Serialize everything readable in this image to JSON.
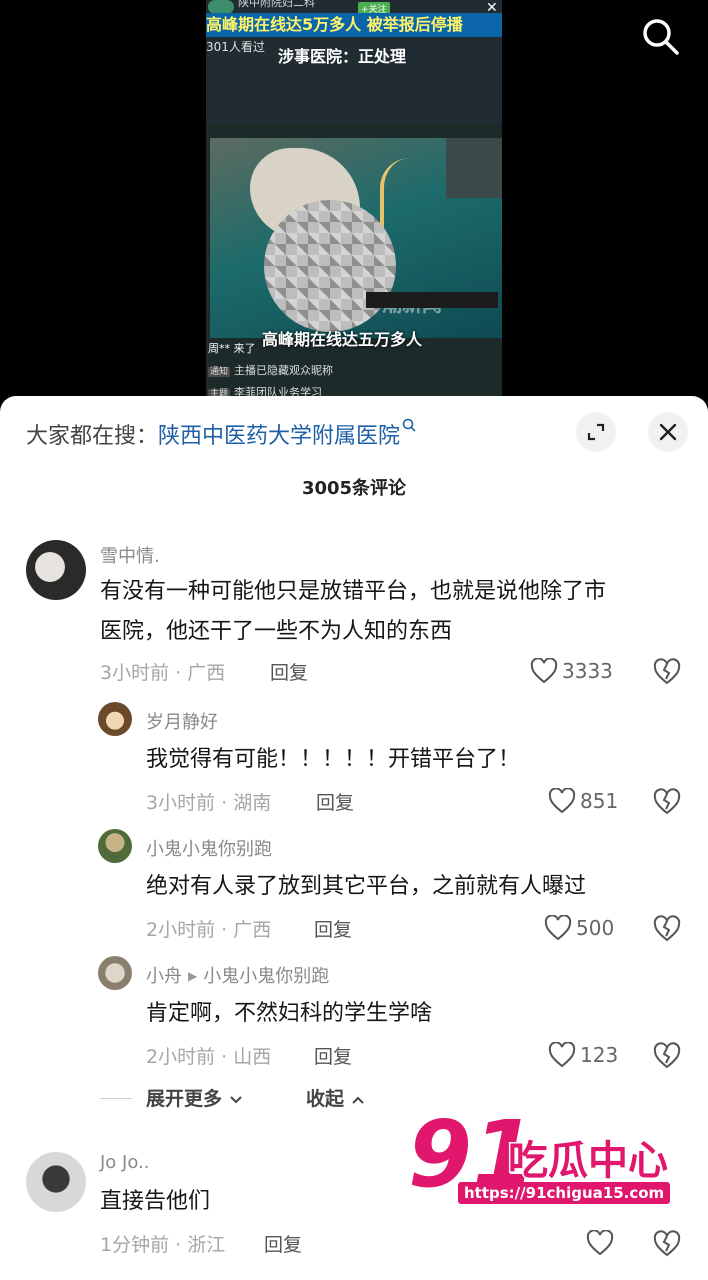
{
  "video": {
    "account_name": "陕中附院妇二科",
    "follow_label": "+关注",
    "headline": "高峰期在线达5万多人 被举报后停播",
    "viewers": "301人看过",
    "hospital_status": "涉事医院：正处理",
    "caption": "高峰期在线达五万多人",
    "user_join": "周** 来了",
    "notice_tag": "通知",
    "notice_text": "主播已隐藏观众昵称",
    "team_tag": "主题",
    "team_text": "李菲团队业务学习",
    "source_watermark": "潮新闻"
  },
  "sheet": {
    "hot_search_prefix": "大家都在搜：",
    "hot_search_link": "陕西中医药大学附属医院",
    "comment_count": "3005条评论"
  },
  "comments": [
    {
      "name": "雪中情.",
      "text_lines": [
        "有没有一种可能他只是放错平台，也就是说他除了市",
        "医院，他还干了一些不为人知的东西"
      ],
      "meta": "3小时前 · 广西",
      "reply_label": "回复",
      "likes": "3333"
    },
    {
      "name": "岁月静好",
      "text": "我觉得有可能！！！！！开错平台了！",
      "meta": "3小时前 · 湖南",
      "reply_label": "回复",
      "likes": "851"
    },
    {
      "name": "小鬼小鬼你别跑",
      "text": "绝对有人录了放到其它平台，之前就有人曝过",
      "meta": "2小时前 · 广西",
      "reply_label": "回复",
      "likes": "500"
    },
    {
      "name": "小舟",
      "reply_to": "小鬼小鬼你别跑",
      "text": "肯定啊，不然妇科的学生学啥",
      "meta": "2小时前 · 山西",
      "reply_label": "回复",
      "likes": "123"
    },
    {
      "name": "Jo Jo..",
      "text": "直接告他们",
      "meta": "1分钟前 · 浙江",
      "reply_label": "回复",
      "likes": ""
    }
  ],
  "thread_controls": {
    "expand_more": "展开更多",
    "collapse": "收起"
  },
  "watermark": {
    "brand": "91吃瓜中心",
    "url": "https://91chigua15.com"
  },
  "icons": {
    "search": "search-icon",
    "expand": "expand-icon",
    "close": "close-icon",
    "like": "heart-icon",
    "dislike": "broken-heart-icon"
  },
  "colors": {
    "link": "#1f5fa8",
    "watermark_pink": "#e0176c"
  }
}
